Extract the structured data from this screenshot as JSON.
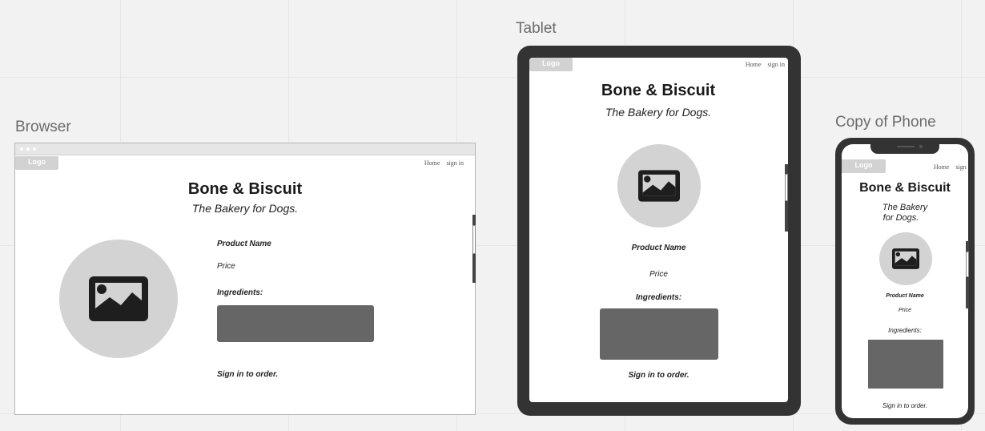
{
  "frames": {
    "browser": {
      "label": "Browser"
    },
    "tablet": {
      "label": "Tablet"
    },
    "phone": {
      "label": "Copy of Phone"
    }
  },
  "site": {
    "logo": "Logo",
    "nav_home": "Home",
    "nav_signin": "sign in",
    "title": "Bone & Biscuit",
    "subtitle": "The Bakery for Dogs.",
    "subtitle_line1": "The Bakery",
    "subtitle_line2": "for Dogs.",
    "product_name": "Product Name",
    "price": "Price",
    "ingredients": "Ingredients:",
    "sign_in_order": "Sign in to order."
  },
  "colors": {
    "canvas": "#f2f2f2",
    "device": "#333333",
    "placeholder_circle": "#d3d3d3",
    "box": "#666666",
    "logo_bg": "#d2d2d2"
  },
  "icons": [
    "image-icon"
  ]
}
